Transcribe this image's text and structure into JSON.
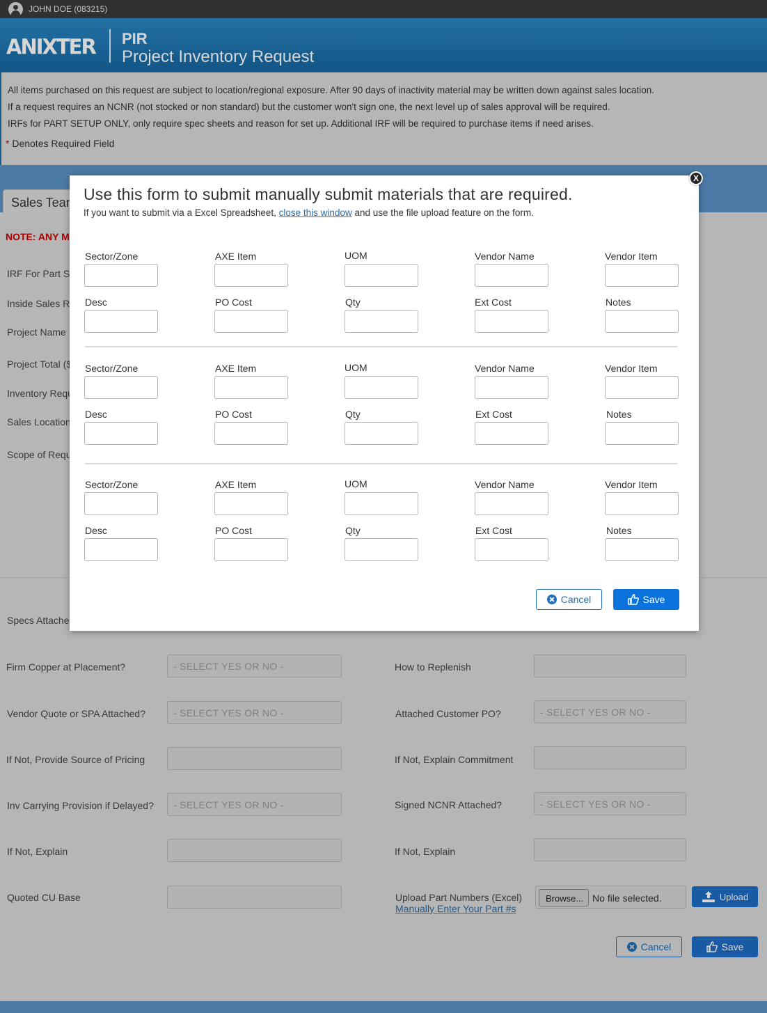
{
  "user": {
    "name": "JOHN DOE (083215)"
  },
  "header": {
    "logo": "ANIXTER",
    "abbr": "PIR",
    "title": "Project Inventory Request"
  },
  "notices": [
    "All items purchased on this request are subject to location/regional exposure.  After 90 days of inactivity material may be written down against sales location.",
    "If a request requires an NCNR (not stocked or non standard) but the customer won't sign one, the next level up of sales approval will be required.",
    "IRFs for PART SETUP ONLY, only require spec sheets and reason for set up.  Additional IRF will be required to purchase items if need arises."
  ],
  "required_note": {
    "star": "*",
    "text": " Denotes Required Field"
  },
  "background": {
    "tab": "Sales Team",
    "note": "NOTE: ANY M",
    "labels": [
      "IRF For Part S",
      "Inside Sales R",
      "Project Name",
      "Project Total ($",
      "Inventory Requ",
      "Sales Location",
      "Scope of Requ",
      "Specs Attached"
    ],
    "left_fields": [
      {
        "label": "Firm Copper at Placement?",
        "value": "- SELECT YES OR  NO -"
      },
      {
        "label": "Vendor Quote or SPA Attached?",
        "value": "- SELECT YES OR  NO -"
      },
      {
        "label": "If Not, Provide Source of Pricing",
        "value": ""
      },
      {
        "label": "Inv Carrying Provision if Delayed?",
        "value": "- SELECT YES OR  NO -"
      },
      {
        "label": "If Not, Explain",
        "value": ""
      },
      {
        "label": "Quoted CU Base",
        "value": ""
      }
    ],
    "right_fields": [
      {
        "label": "How to Replenish",
        "value": ""
      },
      {
        "label": "Attached Customer PO?",
        "value": "- SELECT YES OR  NO -"
      },
      {
        "label": "If Not, Explain Commitment",
        "value": ""
      },
      {
        "label": "Signed NCNR Attached?",
        "value": "- SELECT YES OR  NO -"
      },
      {
        "label": "If Not, Explain",
        "value": ""
      }
    ],
    "upload": {
      "label": "Upload Part Numbers (Excel)",
      "browse": "Browse...",
      "no_file": "No file selected.",
      "button": "Upload",
      "manual_link": "Manually Enter Your Part #s"
    },
    "cancel": "Cancel",
    "save": "Save"
  },
  "modal": {
    "close": "X",
    "title": "Use this form to submit manually submit materials that are required.",
    "sub_before": "If you want to submit via a Excel Spreadsheet, ",
    "sub_link": "close this window",
    "sub_after": " and use the file upload feature on the form.",
    "row1_labels": [
      "Sector/Zone",
      "AXE Item",
      "UOM",
      "Vendor Name",
      "Vendor Item"
    ],
    "row2_labels": [
      "Desc",
      "PO Cost",
      "Qty",
      "Ext Cost",
      "Notes"
    ],
    "cancel": "Cancel",
    "save": "Save"
  },
  "colors": {
    "header_blue": "#1e74b4",
    "button_blue": "#0a73dd",
    "required_red": "#cc0000"
  }
}
